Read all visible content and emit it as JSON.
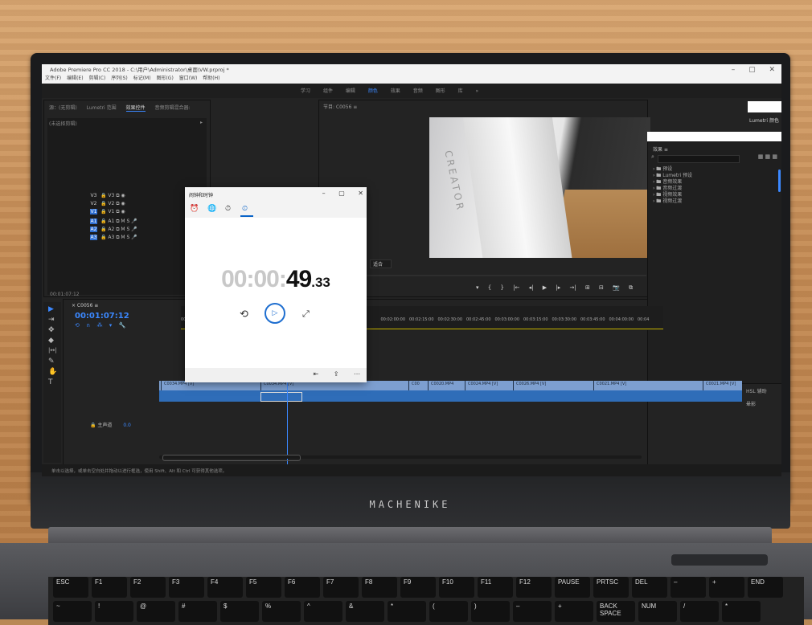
{
  "premiere": {
    "title": "Adobe Premiere Pro CC 2018 - C:\\用户\\Administrator\\桌面\\VW.prproj *",
    "menu": [
      "文件(F)",
      "编辑(E)",
      "剪辑(C)",
      "序列(S)",
      "标记(M)",
      "图形(G)",
      "窗口(W)",
      "帮助(H)"
    ],
    "window_controls": [
      "–",
      "▢",
      "✕"
    ],
    "workspaces": [
      "学习",
      "组件",
      "编辑",
      "颜色",
      "效果",
      "音频",
      "图形",
      "库",
      "»"
    ],
    "active_workspace": "颜色",
    "source_tabs": [
      "源：(无剪辑)",
      "Lumetri 范围",
      "效果控件",
      "音频剪辑混合器:"
    ],
    "source_active_tab": "效果控件",
    "source_header": "(未选择剪辑)",
    "source_header_arrow": "▸",
    "program_title": "节目: C0056 ≡",
    "fit_select": "适合",
    "program_controls": [
      "▾",
      "{",
      "}",
      "|←",
      "◂|",
      "▶",
      "|▸",
      "→|",
      "⊞",
      "⊟",
      "📷",
      "⧉"
    ],
    "lumetri_label": "Lumetri 颜色",
    "effects_title": "效果 ≡",
    "effects_search_icon": "⌕",
    "effects_bin_icons": "▦ ▦ ▦",
    "effects_items": [
      "› 🖿 预设",
      "› 🖿 Lumetri 预设",
      "› 🖿 音频效果",
      "› 🖿 音频过渡",
      "› 🖿 视频效果",
      "› 🖿 视频过渡"
    ],
    "hsl_label": "HSL 辅助",
    "shadow_label": "晕影",
    "small_timecode": "00:01:07:12",
    "tools": [
      "▶",
      "⇥",
      "✥",
      "◆",
      "|↔|",
      "✎",
      "✋",
      "T"
    ],
    "timeline_tab": "× C0056 ≡",
    "timeline_timecode": "00:01:07:12",
    "timeline_icons": [
      "⟲",
      "∩",
      "⁂",
      "▾",
      "🔧"
    ],
    "ruler_labels": [
      "00:00",
      "00:00",
      "",
      "",
      "",
      "",
      "",
      "00:02:00:00",
      "00:02:15:00",
      "00:02:30:00",
      "00:02:45:00",
      "00:03:00:00",
      "00:03:15:00",
      "00:03:30:00",
      "00:03:45:00",
      "00:04:00:00",
      "00:04"
    ],
    "tracks": [
      {
        "name": "V3",
        "on": false,
        "icons": "🔒 V3 ⧉ ◉"
      },
      {
        "name": "V2",
        "on": false,
        "icons": "🔒 V2 ⧉ ◉"
      },
      {
        "name": "V1",
        "on": true,
        "icons": "🔒 V1 ⧉ ◉"
      },
      {
        "name": "A1",
        "on": true,
        "icons": "🔒 A1 ⧉ M S 🎤"
      },
      {
        "name": "A2",
        "on": true,
        "icons": "🔒 A2 ⧉ M S 🎤"
      },
      {
        "name": "A3",
        "on": true,
        "icons": "🔒 A3 ⧉ M S 🎤"
      }
    ],
    "master_label": "🔒 主声道",
    "master_value": "0.0",
    "video_clips": [
      "C0034.MP4 [V]",
      "C0034.MP4 [V]",
      "C00",
      "C0020.MP4",
      "C0024.MP4 [V]",
      "C0026.MP4 [V]",
      "C0021.MP4 [V]",
      "C0021.MP4 [V]"
    ],
    "status_text": "单击以选择，或单击空白处并拖动以进行框选，使用 Shift、Alt 和 Ctrl 可获得其他选项。"
  },
  "clock_app": {
    "title": "闹钟和时钟",
    "window_controls": [
      "–",
      "▢",
      "✕"
    ],
    "tabs": [
      "⏰",
      "🌐",
      "⏱",
      "⏲"
    ],
    "active_tab_index": 3,
    "time_dim": "00:00:",
    "time_seconds": "49",
    "time_centis": ".33",
    "reset_icon": "⟲",
    "play_icon": "▷",
    "expand_icon": "⤢",
    "bottom_icons": [
      "⇤",
      "⇪",
      "⋯"
    ]
  },
  "laptop": {
    "brand": "MACHENIKE",
    "keys_top": [
      "ESC",
      "F1",
      "F2",
      "F3",
      "F4",
      "F5",
      "F6",
      "F7",
      "F8",
      "F9",
      "F10",
      "F11",
      "F12",
      "PAUSE",
      "PRTSC",
      "DEL",
      "–",
      "+",
      "END"
    ],
    "keys_second": [
      "~",
      "!",
      "@",
      "#",
      "$",
      "%",
      "^",
      "&",
      "*",
      "(",
      ")",
      "–",
      "+",
      "BACK SPACE",
      "NUM",
      "/",
      "*"
    ]
  },
  "colors": {
    "accent": "#3b88ff",
    "clock_accent": "#1f6fd0",
    "clip_video": "#7d9fd0",
    "clip_audio": "#2f6db8"
  }
}
